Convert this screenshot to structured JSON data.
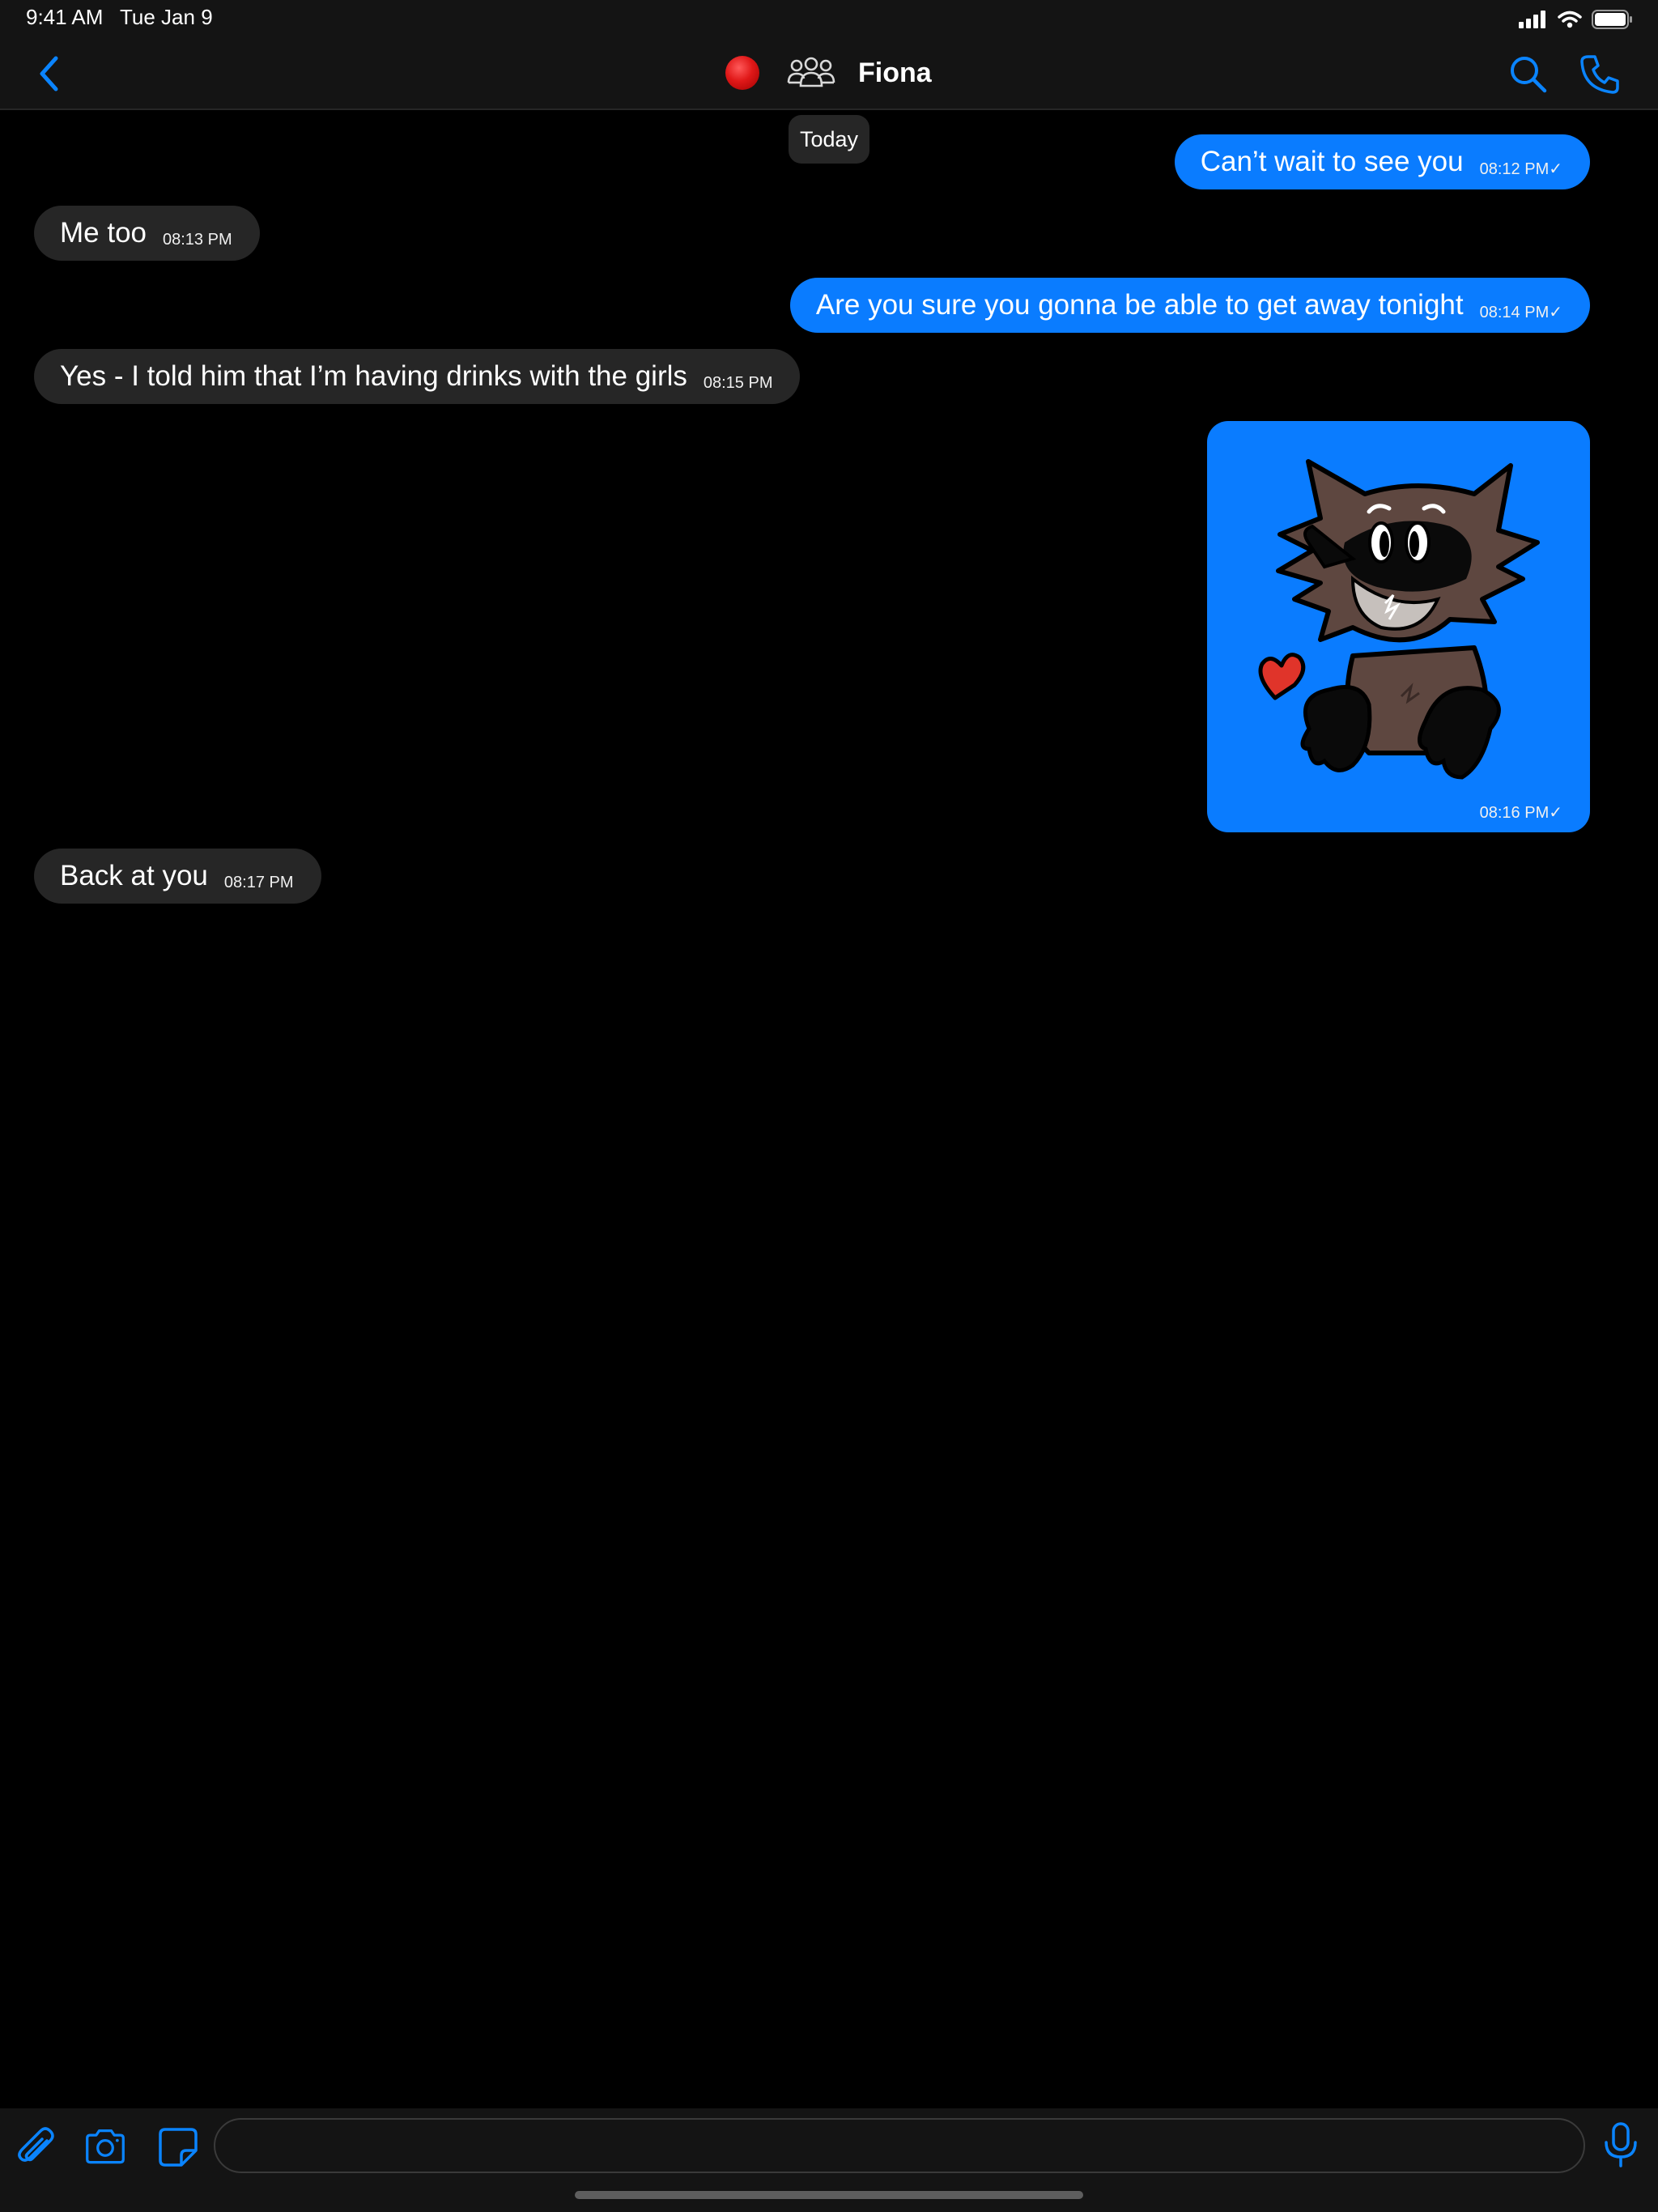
{
  "status_bar": {
    "time": "9:41 AM",
    "date": "Tue Jan 9",
    "icons": [
      "cellular-icon",
      "wifi-icon",
      "battery-icon"
    ]
  },
  "nav": {
    "back_icon": "chevron-left-icon",
    "status_indicator": "red-dot",
    "group_icon": "group-people-icon",
    "contact_name": "Fiona",
    "search_icon": "search-icon",
    "call_icon": "phone-icon"
  },
  "chat": {
    "date_label": "Today",
    "messages": [
      {
        "direction": "out",
        "text": "Can’t wait to see you",
        "time": "08:12 PM✓"
      },
      {
        "direction": "in",
        "text": "Me too",
        "time": "08:13 PM"
      },
      {
        "direction": "out",
        "text": "Are you sure you gonna be able to get away tonight",
        "time": "08:14 PM✓"
      },
      {
        "direction": "in",
        "text": "Yes - I told him that I’m having drinks with the girls",
        "time": "08:15 PM"
      },
      {
        "direction": "out",
        "type": "sticker",
        "sticker": "raccoon-heart-sticker",
        "time": "08:16 PM✓"
      },
      {
        "direction": "in",
        "text": "Back at you",
        "time": "08:17 PM"
      }
    ]
  },
  "input_bar": {
    "attach_icon": "paperclip-icon",
    "camera_icon": "camera-icon",
    "sticker_icon": "sticker-icon",
    "message_placeholder": "",
    "mic_icon": "microphone-icon"
  },
  "colors": {
    "background": "#000000",
    "bar": "#141414",
    "accent": "#0a7cff",
    "incoming_bubble": "#262626"
  }
}
